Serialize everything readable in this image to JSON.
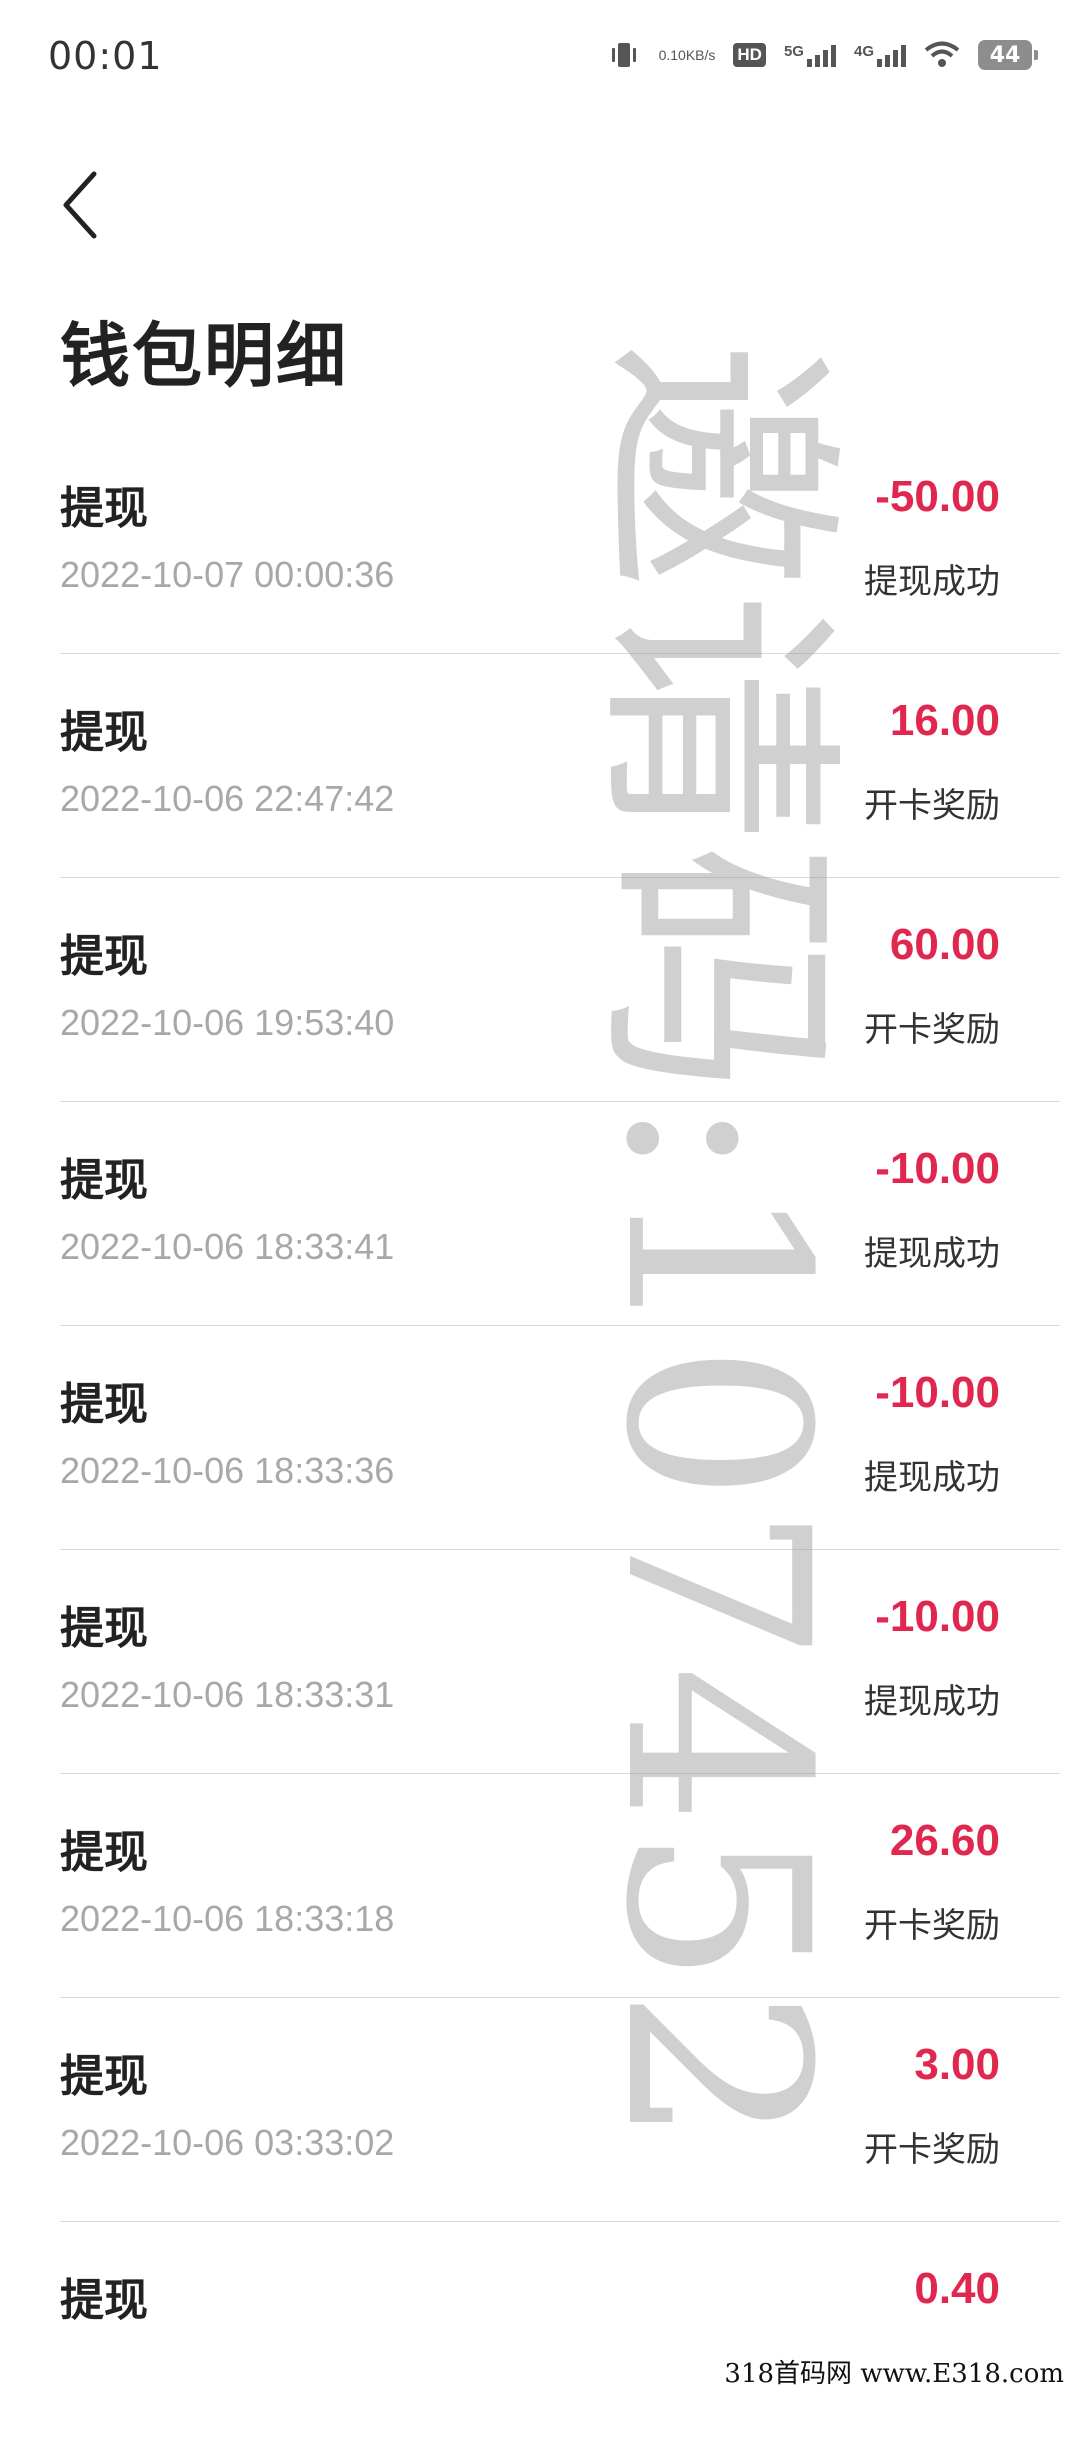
{
  "status_bar": {
    "time": "00:01",
    "net_speed_value": "0.10",
    "net_speed_unit": "KB/s",
    "hd_label": "HD",
    "sim1_label": "5G",
    "sim2_label": "4G",
    "battery": "44"
  },
  "page": {
    "title": "钱包明细"
  },
  "rows": [
    {
      "type": "提现",
      "time": "2022-10-07 00:00:36",
      "amount": "-50.00",
      "status": "提现成功"
    },
    {
      "type": "提现",
      "time": "2022-10-06 22:47:42",
      "amount": "16.00",
      "status": "开卡奖励"
    },
    {
      "type": "提现",
      "time": "2022-10-06 19:53:40",
      "amount": "60.00",
      "status": "开卡奖励"
    },
    {
      "type": "提现",
      "time": "2022-10-06 18:33:41",
      "amount": "-10.00",
      "status": "提现成功"
    },
    {
      "type": "提现",
      "time": "2022-10-06 18:33:36",
      "amount": "-10.00",
      "status": "提现成功"
    },
    {
      "type": "提现",
      "time": "2022-10-06 18:33:31",
      "amount": "-10.00",
      "status": "提现成功"
    },
    {
      "type": "提现",
      "time": "2022-10-06 18:33:18",
      "amount": "26.60",
      "status": "开卡奖励"
    },
    {
      "type": "提现",
      "time": "2022-10-06 03:33:02",
      "amount": "3.00",
      "status": "开卡奖励"
    },
    {
      "type": "提现",
      "time": "",
      "amount": "0.40",
      "status": ""
    }
  ],
  "watermark": {
    "text": "邀请码:107452"
  },
  "footer": {
    "credit": "318首码网 www.E318.com"
  },
  "colors": {
    "amount": "#e0274f",
    "time": "#a8a8a8",
    "divider": "#d9d9d9"
  }
}
